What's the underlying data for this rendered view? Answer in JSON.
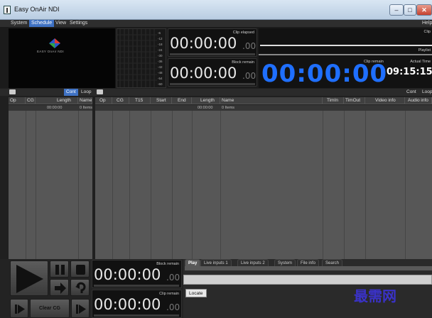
{
  "window": {
    "title": "Easy OnAir NDI",
    "min": "–",
    "max": "□",
    "close": "✕"
  },
  "menu": {
    "items": [
      "System",
      "Schedule",
      "View",
      "Settings"
    ],
    "active_index": 1,
    "help": "Help"
  },
  "logo": {
    "text": "EASY OnAir NDI"
  },
  "vu": {
    "scale": [
      "-6",
      "-12",
      "-18",
      "-24",
      "-30",
      "-36",
      "-42",
      "-48",
      "-54",
      "-60"
    ]
  },
  "timers": {
    "clip_elapsed": {
      "label": "Clip elapsed",
      "main": "00:00:00",
      "frac": ".00"
    },
    "block_remain": {
      "label": "Block remain",
      "main": "00:00:00",
      "frac": ".00"
    },
    "clip_remain_big": {
      "label": "Clip remain",
      "value": "00:00:00"
    },
    "clip_top": "Clip",
    "playlist": "Playlist",
    "actual_time": {
      "label": "Actual Time",
      "value": "09:15:15"
    }
  },
  "left_panel": {
    "cont": "Cont",
    "loop": "Loop",
    "columns": [
      "Op",
      "CG",
      "Length",
      "Name"
    ],
    "row": {
      "length": "00:00:00",
      "name": "0 Items"
    }
  },
  "right_panel": {
    "cont": "Cont",
    "loop": "Loop",
    "columns": [
      "Op",
      "CG",
      "T15",
      "Start",
      "End",
      "Length",
      "Name",
      "TimIn",
      "TimOut",
      "Video info",
      "Audio info"
    ],
    "row": {
      "length": "00:00:00",
      "name": "0 Items"
    }
  },
  "bottom": {
    "block_remain": {
      "label": "Block remain",
      "main": "00:00:00",
      "frac": ".00"
    },
    "clip_remain": {
      "label": "Clip remain",
      "main": "00:00:00",
      "frac": ".00"
    },
    "clear_cg": "Clear CG",
    "tabs": [
      "Play",
      "Live inputs 1",
      "Live inputs 2",
      "System",
      "File info",
      "Search"
    ],
    "active_tab": 0,
    "locate": "Locate"
  },
  "watermark": "最需网"
}
